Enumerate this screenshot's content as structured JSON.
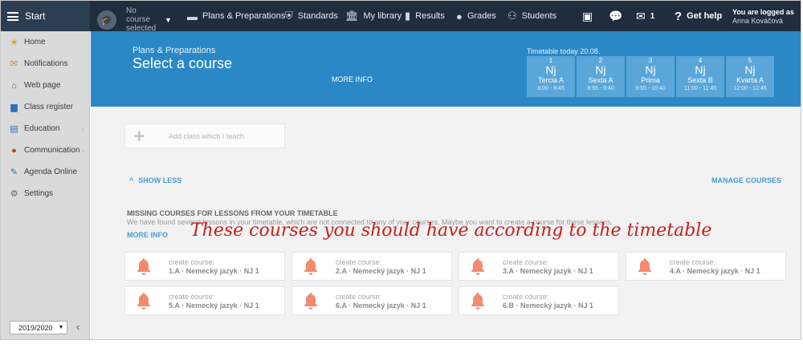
{
  "topbar": {
    "start_label": "Start",
    "course_selector": "No course selected",
    "nav": [
      {
        "label": "Plans & Preparations",
        "icon": "plans-icon"
      },
      {
        "label": "Standards",
        "icon": "shield-icon"
      },
      {
        "label": "My library",
        "icon": "library-icon"
      },
      {
        "label": "Results",
        "icon": "bar-chart-icon"
      },
      {
        "label": "Grades",
        "icon": "grades-icon"
      },
      {
        "label": "Students",
        "icon": "students-icon"
      }
    ],
    "mail_count": "1",
    "help_label": "Get help",
    "logged_in_label": "You are logged as",
    "user_name": "Anna Kováčová"
  },
  "sidebar": {
    "items": [
      {
        "label": "Home",
        "icon": "star-icon"
      },
      {
        "label": "Notifications",
        "icon": "envelope-icon"
      },
      {
        "label": "Web page",
        "icon": "house-icon"
      },
      {
        "label": "Class register",
        "icon": "book-icon"
      },
      {
        "label": "Education",
        "icon": "education-icon"
      },
      {
        "label": "Communication",
        "icon": "chat-icon"
      },
      {
        "label": "Agenda Online",
        "icon": "pen-icon"
      },
      {
        "label": "Settings",
        "icon": "gear-icon"
      }
    ],
    "school_year": "2019/2020"
  },
  "banner": {
    "subtitle": "Plans & Preparations",
    "title": "Select a course",
    "more_info": "MORE INFO",
    "timetable_label": "Timetable today 20.08.",
    "slots": [
      {
        "num": "1",
        "subject": "Nj",
        "class": "Tercia A",
        "time": "8:00 - 8:45"
      },
      {
        "num": "2",
        "subject": "Nj",
        "class": "Sexta A",
        "time": "8:55 - 9:40"
      },
      {
        "num": "3",
        "subject": "Nj",
        "class": "Prima",
        "time": "9:55 - 10:40"
      },
      {
        "num": "4",
        "subject": "Nj",
        "class": "Sexta B",
        "time": "11:00 - 11:45"
      },
      {
        "num": "5",
        "subject": "Nj",
        "class": "Kvarta A",
        "time": "12:00 - 12:45"
      }
    ]
  },
  "content": {
    "add_class": "Add class which I teach",
    "show_less": "SHOW LESS",
    "manage_courses": "MANAGE COURSES",
    "missing_heading": "MISSING COURSES FOR LESSONS FROM YOUR TIMETABLE",
    "missing_desc": "We have found several lessons in your timetable, which are not connected to any of your courses. Maybe you want to create a course for these lessons.",
    "more_info": "MORE INFO",
    "overlay_note": "These courses you should have according to the timetable",
    "create_label": "create course:",
    "cards": [
      "1.A · Nemecký jazyk · NJ 1",
      "2.A · Nemecký jazyk · NJ 1",
      "3.A · Nemecký jazyk · NJ 1",
      "4.A · Nemecký jazyk · NJ 1",
      "5.A · Nemecký jazyk · NJ 1",
      "6.A · Nemecký jazyk · NJ 1",
      "6.B · Nemecký jazyk · NJ 1"
    ]
  },
  "colors": {
    "topbar": "#1f2d3e",
    "banner": "#2b88c6",
    "slot": "#5aa6d9",
    "link": "#4a9bd4",
    "bell": "#f28b6e",
    "overlay": "#c91f1f"
  }
}
